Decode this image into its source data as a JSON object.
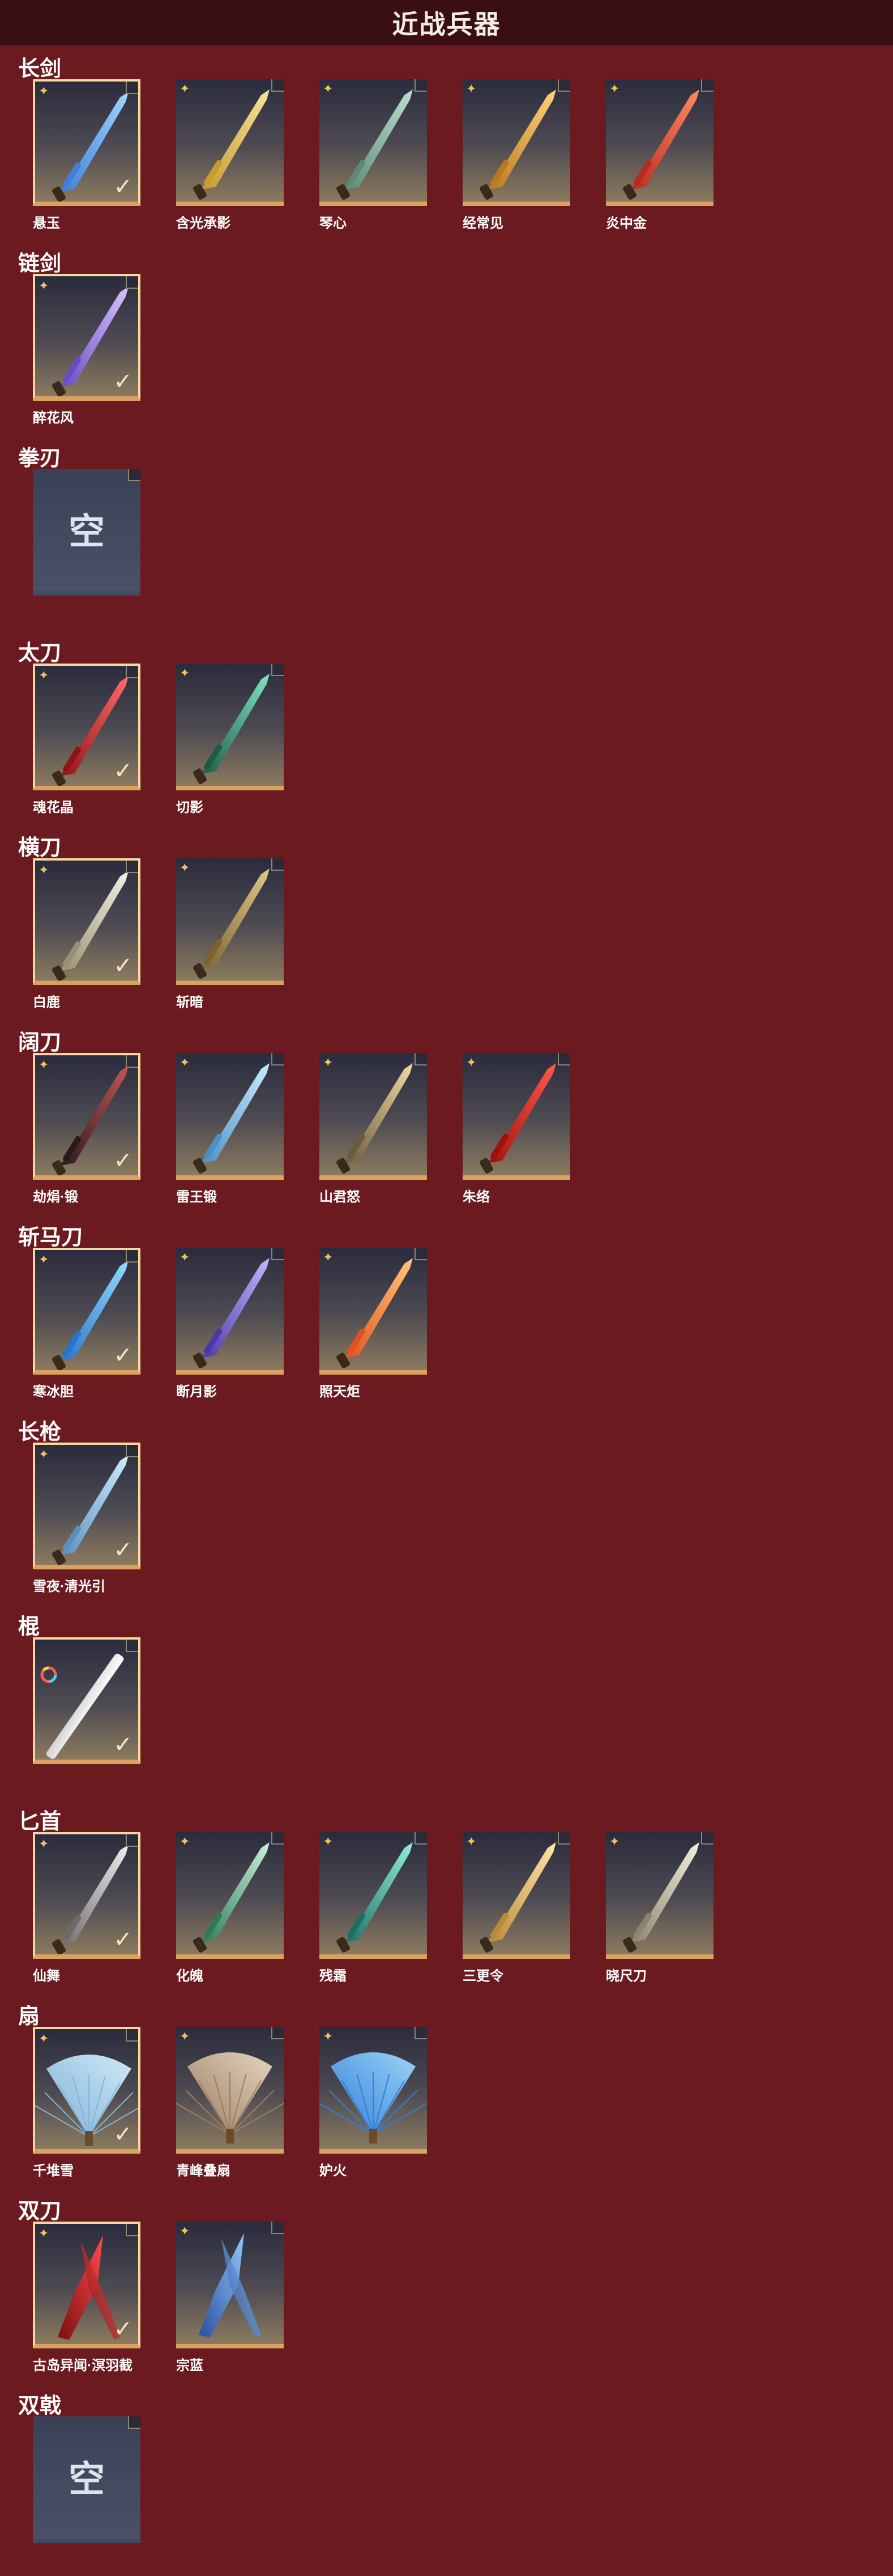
{
  "header": {
    "title": "近战兵器"
  },
  "colors": {
    "background": "#6b1a1f",
    "header": "#3a0f13",
    "accent": "#d9a261",
    "selected_border": "#f6d9a2"
  },
  "empty_label": "空",
  "sections": [
    {
      "title": "长剑",
      "items": [
        {
          "name": "悬玉",
          "selected": true,
          "icon": "blue-sword-icon"
        },
        {
          "name": "含光承影",
          "selected": false,
          "icon": "golden-sword-icon"
        },
        {
          "name": "琴心",
          "selected": false,
          "icon": "jade-sword-icon"
        },
        {
          "name": "经常见",
          "selected": false,
          "icon": "gold-ornate-sword-icon"
        },
        {
          "name": "炎中金",
          "selected": false,
          "icon": "red-sword-icon"
        }
      ]
    },
    {
      "title": "链剑",
      "items": [
        {
          "name": "醉花风",
          "selected": true,
          "icon": "purple-chain-sword-icon"
        }
      ]
    },
    {
      "title": "拳刃",
      "items": []
    },
    {
      "title": "太刀",
      "items": [
        {
          "name": "魂花晶",
          "selected": true,
          "icon": "crimson-katana-icon"
        },
        {
          "name": "切影",
          "selected": false,
          "icon": "green-katana-icon"
        }
      ]
    },
    {
      "title": "横刀",
      "items": [
        {
          "name": "白鹿",
          "selected": true,
          "icon": "white-saber-icon"
        },
        {
          "name": "斩暗",
          "selected": false,
          "icon": "bronze-saber-icon"
        }
      ]
    },
    {
      "title": "阔刀",
      "items": [
        {
          "name": "劫焆·锻",
          "selected": true,
          "icon": "dark-broadblade-icon"
        },
        {
          "name": "雷王锻",
          "selected": false,
          "icon": "ice-broadblade-icon"
        },
        {
          "name": "山君怒",
          "selected": false,
          "icon": "tiger-broadblade-icon"
        },
        {
          "name": "朱络",
          "selected": false,
          "icon": "red-broadblade-icon"
        }
      ]
    },
    {
      "title": "斩马刀",
      "items": [
        {
          "name": "寒冰胆",
          "selected": true,
          "icon": "ice-glaive-icon"
        },
        {
          "name": "断月影",
          "selected": false,
          "icon": "violet-glaive-icon"
        },
        {
          "name": "照天炬",
          "selected": false,
          "icon": "flame-glaive-icon"
        }
      ]
    },
    {
      "title": "长枪",
      "items": [
        {
          "name": "雪夜·清光引",
          "selected": true,
          "icon": "frost-spear-icon"
        }
      ]
    },
    {
      "title": "棍",
      "items": [
        {
          "name": "",
          "selected": true,
          "icon": "white-staff-icon",
          "rainbow": true
        }
      ]
    },
    {
      "title": "匕首",
      "items": [
        {
          "name": "仙舞",
          "selected": true,
          "icon": "silver-dagger-icon"
        },
        {
          "name": "化魄",
          "selected": false,
          "icon": "green-dagger-icon"
        },
        {
          "name": "残霜",
          "selected": false,
          "icon": "teal-dagger-icon"
        },
        {
          "name": "三更令",
          "selected": false,
          "icon": "gold-dagger-icon"
        },
        {
          "name": "晓尺刀",
          "selected": false,
          "icon": "pale-dagger-icon"
        }
      ]
    },
    {
      "title": "扇",
      "items": [
        {
          "name": "千堆雪",
          "selected": true,
          "icon": "ice-fan-icon"
        },
        {
          "name": "青峰叠扇",
          "selected": false,
          "icon": "paper-fan-icon"
        },
        {
          "name": "妒火",
          "selected": false,
          "icon": "blue-feather-fan-icon"
        }
      ]
    },
    {
      "title": "双刀",
      "items": [
        {
          "name": "古岛异闻·溟羽截",
          "selected": true,
          "icon": "crimson-twin-blades-icon"
        },
        {
          "name": "宗蓝",
          "selected": false,
          "icon": "blue-twin-blades-icon"
        }
      ]
    },
    {
      "title": "双戟",
      "items": []
    }
  ]
}
